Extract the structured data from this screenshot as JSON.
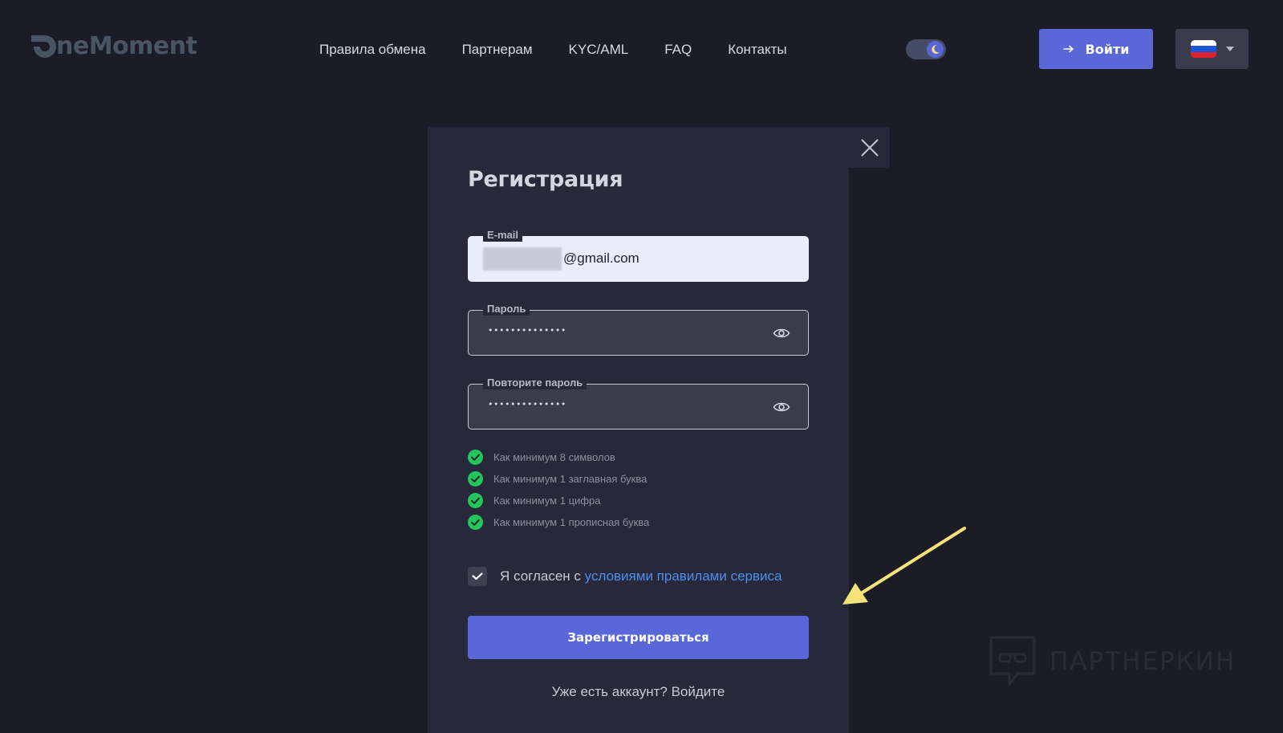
{
  "header": {
    "logo_text": "neMoment",
    "nav": [
      {
        "label": "Правила обмена"
      },
      {
        "label": "Партнерам"
      },
      {
        "label": "KYC/AML"
      },
      {
        "label": "FAQ"
      },
      {
        "label": "Контакты"
      }
    ],
    "login_label": "Войти",
    "language": {
      "selected": "RU",
      "icon": "russia-flag-icon"
    },
    "theme": "dark"
  },
  "modal": {
    "title": "Регистрация",
    "email": {
      "label": "E-mail",
      "value": "@gmail.com"
    },
    "password": {
      "label": "Пароль",
      "value": "••••••••••••••"
    },
    "password_repeat": {
      "label": "Повторите пароль",
      "value": "••••••••••••••"
    },
    "rules": [
      {
        "text": "Как минимум 8 символов",
        "met": true
      },
      {
        "text": "Как минимум 1 заглавная буква",
        "met": true
      },
      {
        "text": "Как минимум 1 цифра",
        "met": true
      },
      {
        "text": "Как минимум 1 прописная буква",
        "met": true
      }
    ],
    "agree": {
      "checked": true,
      "prefix": "Я согласен с",
      "link": "условиями правилами сервиса"
    },
    "submit_label": "Зарегистрироваться",
    "footer_text": "Уже есть аккаунт? Войдите"
  },
  "watermark": {
    "text": "ПАРТНЕРКИН"
  },
  "colors": {
    "background": "#1c1c27",
    "modal": "#272839",
    "accent": "#5a67d8",
    "link": "#4d8ff0",
    "check": "#22c55e",
    "annotation": "#f4e27a"
  }
}
